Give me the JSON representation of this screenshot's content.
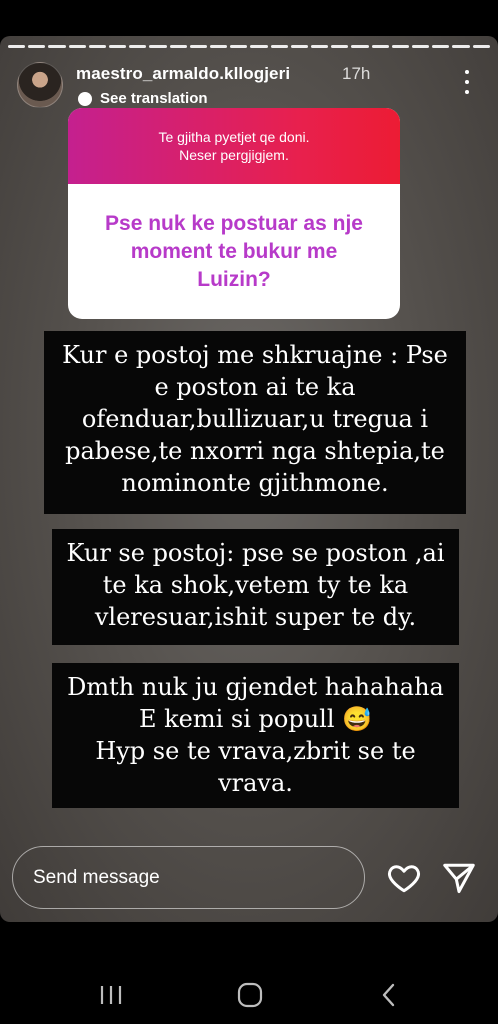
{
  "story": {
    "username": "maestro_armaldo.kllogjeri",
    "time": "17h",
    "translate_label": "See translation",
    "more_icon": "more-vertical-icon"
  },
  "question_sticker": {
    "header_line1": "Te gjitha pyetjet qe doni.",
    "header_line2": "Neser pergjigjem.",
    "question": "Pse nuk ke postuar as nje moment te bukur me Luizin?",
    "gradient_colors": [
      "#c4208f",
      "#ec1c34"
    ],
    "text_color": "#b73ac9"
  },
  "text_blocks": [
    "Kur e postoj me shkruajne : Pse e poston ai te ka ofenduar,bullizuar,u tregua i pabese,te nxorri nga shtepia,te nominonte gjithmone.",
    "Kur se postoj: pse se poston ,ai te ka shok,vetem ty te ka vleresuar,ishit super te dy.",
    "Dmth nuk ju gjendet hahahaha\nE kemi si popull 😅\nHyp se te vrava,zbrit se te vrava."
  ],
  "reply": {
    "placeholder": "Send message",
    "like_icon": "heart-icon",
    "share_icon": "paper-plane-icon"
  },
  "navigation": {
    "recent_icon": "recent-apps-icon",
    "home_icon": "home-icon",
    "back_icon": "back-icon"
  }
}
